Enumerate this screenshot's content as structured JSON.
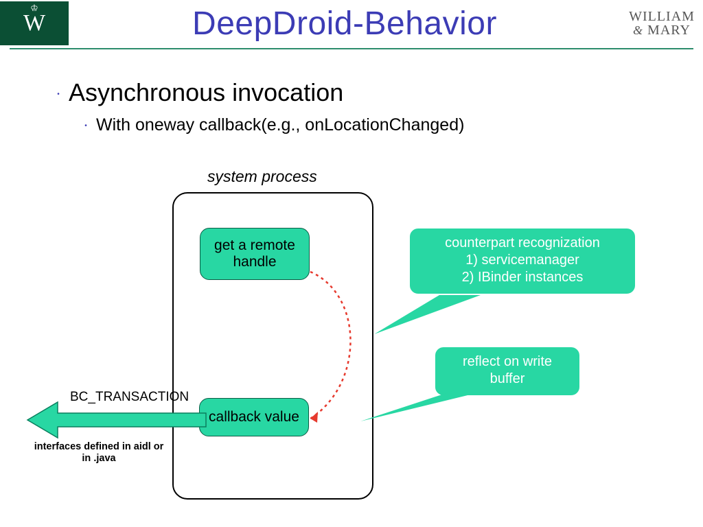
{
  "header": {
    "title": "DeepDroid-Behavior",
    "wm_left": "W",
    "wm_right_line1": "WILLIAM",
    "wm_right_line2": "& MARY"
  },
  "bullets": {
    "main": "Asynchronous invocation",
    "sub": "With oneway callback(e.g., onLocationChanged)"
  },
  "diagram": {
    "process_label": "system process",
    "node_remote": "get a remote handle",
    "node_callback": "callback value",
    "arrow_bc": "BC_TRANSACTION",
    "note_interfaces": "interfaces defined in aidl or in .java"
  },
  "callouts": {
    "counterpart_title": "counterpart recognization",
    "counterpart_l1": "1)  servicemanager",
    "counterpart_l2": "2)  IBinder instances",
    "reflect": "reflect on write buffer"
  }
}
